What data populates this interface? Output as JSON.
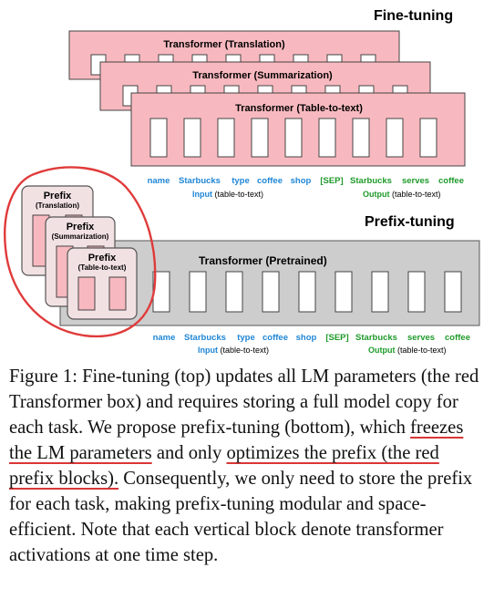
{
  "figure": {
    "finetune_heading": "Fine-tuning",
    "prefixtune_heading": "Prefix-tuning",
    "ft_boxes": [
      {
        "label": "Transformer (Translation)"
      },
      {
        "label": "Transformer (Summarization)"
      },
      {
        "label": "Transformer (Table-to-text)"
      }
    ],
    "pretrained_label": "Transformer  (Pretrained)",
    "prefix_boxes": [
      {
        "title": "Prefix",
        "sub": "(Translation)"
      },
      {
        "title": "Prefix",
        "sub": "(Summarization)"
      },
      {
        "title": "Prefix",
        "sub": "(Table-to-text)"
      }
    ],
    "tokens": [
      {
        "text": "name",
        "kind": "input"
      },
      {
        "text": "Starbucks",
        "kind": "input"
      },
      {
        "text": "type",
        "kind": "input"
      },
      {
        "text": "coffee",
        "kind": "input"
      },
      {
        "text": "shop",
        "kind": "input"
      },
      {
        "text": "[SEP]",
        "kind": "output"
      },
      {
        "text": "Starbucks",
        "kind": "output"
      },
      {
        "text": "serves",
        "kind": "output"
      },
      {
        "text": "coffee",
        "kind": "output"
      }
    ],
    "input_label_bold": "Input",
    "input_label_rest": " (table-to-text)",
    "output_label_bold": "Output",
    "output_label_rest": " (table-to-text)",
    "colors": {
      "ft_fill": "#f7b9bf",
      "pretrained_fill": "#cdcdcd",
      "input_blue": "#1f86d6",
      "output_green": "#1f9a2a",
      "annotation_red": "#e03b3b"
    }
  },
  "caption": {
    "text1": "Figure 1:   Fine-tuning (top) updates all LM parameters (the red Transformer box) and requires storing a full model copy for each task.  We propose prefix-tuning (bottom), which ",
    "underline1": "freezes the LM parameters",
    "text2": " and only ",
    "underline2": "optimizes the prefix (the red prefix blocks).",
    "text3": " Consequently, we only need to store the prefix for each task, making prefix-tuning modular and space-efficient. Note that each vertical block denote transformer activations at one time step."
  }
}
